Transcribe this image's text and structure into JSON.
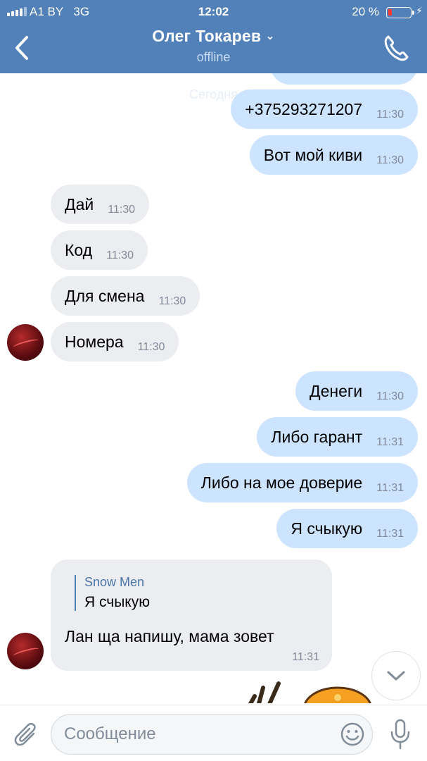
{
  "status_bar": {
    "carrier": "A1 BY",
    "network": "3G",
    "time": "12:02",
    "battery": "20 %"
  },
  "header": {
    "title": "Олег Токарев",
    "subtitle": "offline"
  },
  "chat": {
    "date_separator": "Сегодня",
    "messages": [
      {
        "text": "+375293271207",
        "time": "11:30"
      },
      {
        "text": "Вот мой киви",
        "time": "11:30"
      },
      {
        "text": "Дай",
        "time": "11:30"
      },
      {
        "text": "Код",
        "time": "11:30"
      },
      {
        "text": "Для смена",
        "time": "11:30"
      },
      {
        "text": "Номера",
        "time": "11:30"
      },
      {
        "text": "Денеги",
        "time": "11:30"
      },
      {
        "text": "Либо гарант",
        "time": "11:31"
      },
      {
        "text": "Либо на мое доверие",
        "time": "11:31"
      },
      {
        "text": "Я счыкую",
        "time": "11:31"
      }
    ],
    "reply": {
      "quote_author": "Snow Men",
      "quote_text": "Я счыкую",
      "text": "Лан ща напишу, мама зовет",
      "time": "11:31"
    }
  },
  "composer": {
    "placeholder": "Сообщение"
  },
  "colors": {
    "header": "#5181b8",
    "outgoing": "#cce4ff",
    "incoming": "#ebedf0"
  }
}
